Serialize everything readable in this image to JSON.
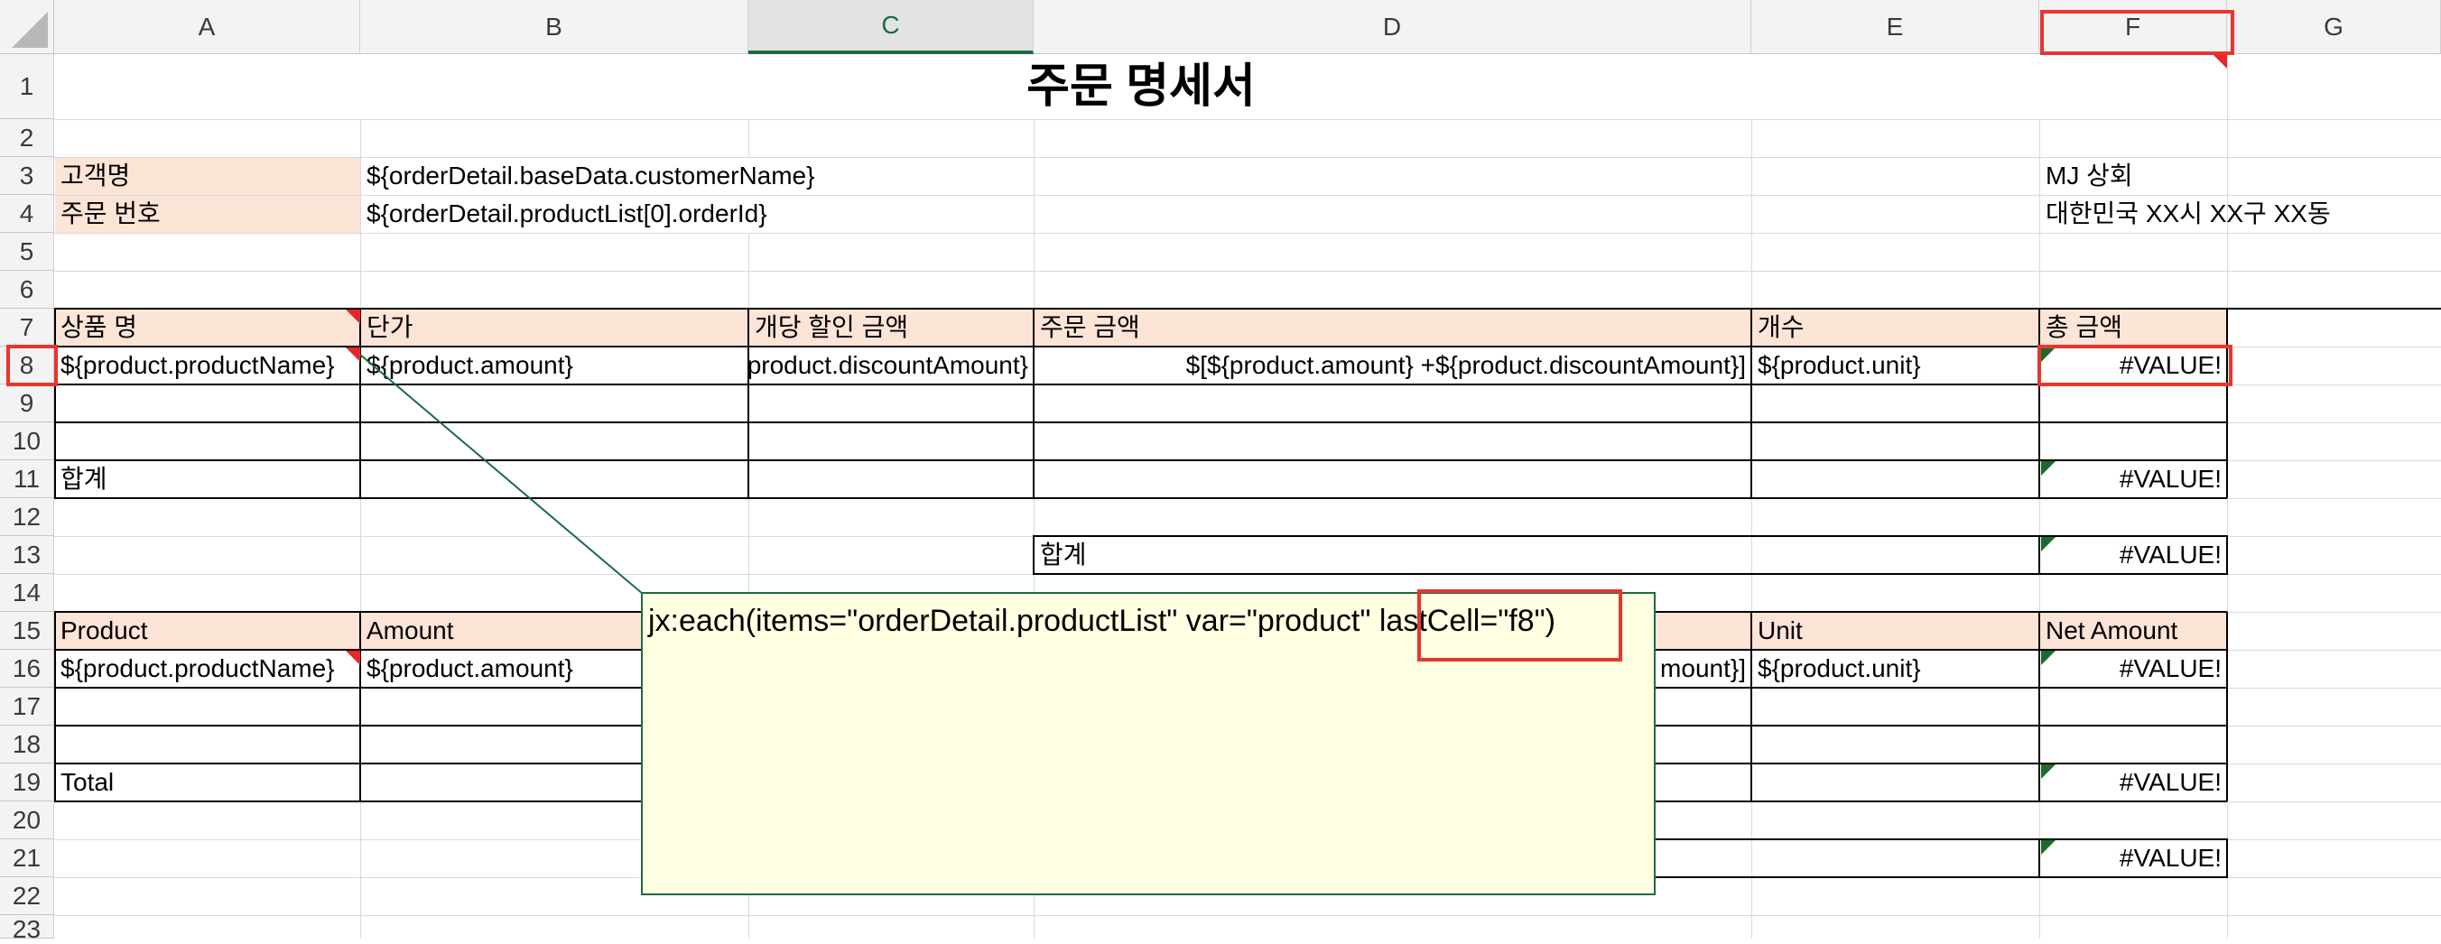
{
  "columns": [
    "A",
    "B",
    "C",
    "D",
    "E",
    "F",
    "G"
  ],
  "selected_column": "C",
  "rows": [
    "1",
    "2",
    "3",
    "4",
    "5",
    "6",
    "7",
    "8",
    "9",
    "10",
    "11",
    "12",
    "13",
    "14",
    "15",
    "16",
    "17",
    "18",
    "19",
    "20",
    "21",
    "22",
    "23"
  ],
  "title": "주문 명세서",
  "customer": {
    "label": "고객명",
    "value": "${orderDetail.baseData.customerName}",
    "company": "MJ 상회"
  },
  "order": {
    "label": "주문 번호",
    "value": "${orderDetail.productList[0].orderId}",
    "address": "대한민국 XX시 XX구 XX동"
  },
  "korean_table": {
    "headers": [
      "상품 명",
      "단가",
      "개당 할인 금액",
      "주문 금액",
      "개수",
      "총 금액"
    ],
    "row": [
      "${product.productName}",
      "${product.amount}",
      "${product.discountAmount}",
      "$[${product.amount} +${product.discountAmount}]",
      "${product.unit}",
      "#VALUE!"
    ],
    "total_label": "합계",
    "total_value": "#VALUE!",
    "summary_label": "합계",
    "summary_value": "#VALUE!"
  },
  "english_table": {
    "headers": [
      "Product",
      "Amount",
      "Unit",
      "Net Amount"
    ],
    "row": [
      "${product.productName}",
      "${product.amount}",
      "mount}]",
      "${product.unit}",
      "#VALUE!"
    ],
    "total_label": "Total",
    "total_value": "#VALUE!",
    "summary_value": "#VALUE!"
  },
  "comment": {
    "text": "jx:each(items=\"orderDetail.productList\" var=\"product\" ",
    "highlight": "lastCell=\"f8\")"
  },
  "colors": {
    "header_fill": "#fce4d6",
    "selected_header": "#1e6b41",
    "highlight_box": "#e8362e",
    "comment_bg": "#ffffe1"
  }
}
